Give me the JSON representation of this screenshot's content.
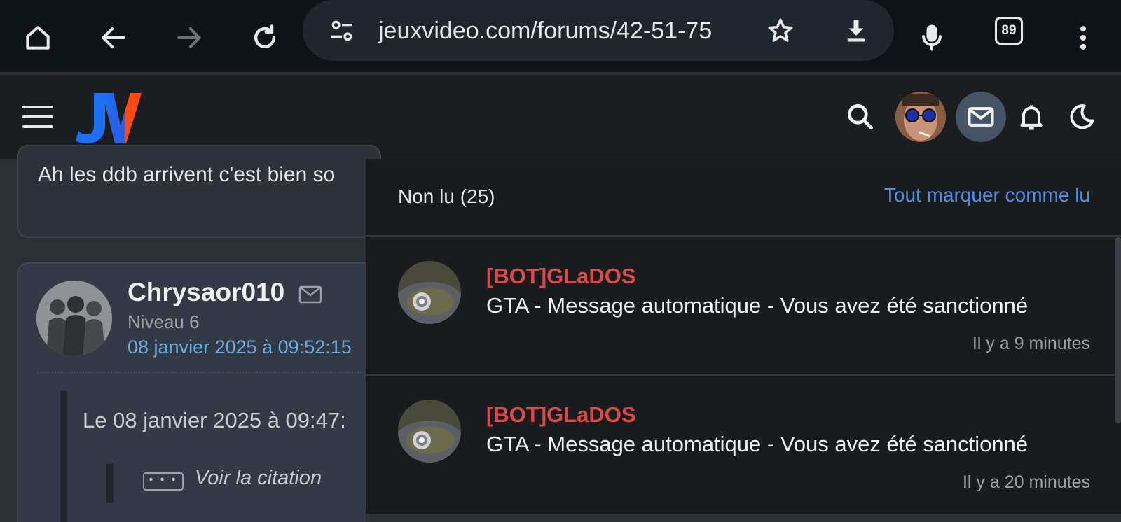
{
  "browser": {
    "url": "jeuxvideo.com/forums/42-51-75",
    "tab_count": "89",
    "icons": [
      "home-icon",
      "back-icon",
      "forward-icon",
      "reload-icon",
      "site-settings-icon",
      "bookmark-star-icon",
      "download-icon",
      "mic-icon",
      "tab-switcher-icon",
      "overflow-menu-icon"
    ]
  },
  "header": {
    "logo_text": "JV",
    "logo_colors": {
      "j": "#1d6ff2",
      "v": "#ff4a12"
    }
  },
  "post_previous": {
    "text": "Ah les ddb arrivent c'est bien so"
  },
  "post": {
    "author": "Chrysaor010",
    "level": "Niveau 6",
    "date": "08 janvier 2025 à 09:52:15",
    "quote_header": "Le 08 janvier 2025 à 09:47:",
    "quote_dots": "• • •",
    "quote_toggle": "Voir la citation"
  },
  "notifications": {
    "title": "Non lu (25)",
    "mark_all": "Tout marquer comme lu",
    "items": [
      {
        "sender": "[BOT]GLaDOS",
        "subject": "GTA - Message automatique - Vous avez été sanctionné",
        "time": "Il y a 9 minutes"
      },
      {
        "sender": "[BOT]GLaDOS",
        "subject": "GTA - Message automatique - Vous avez été sanctionné",
        "time": "Il y a 20 minutes"
      }
    ]
  },
  "colors": {
    "link_blue": "#4d8fe0",
    "sender_red": "#d94b4b",
    "date_blue": "#6aacdf"
  }
}
